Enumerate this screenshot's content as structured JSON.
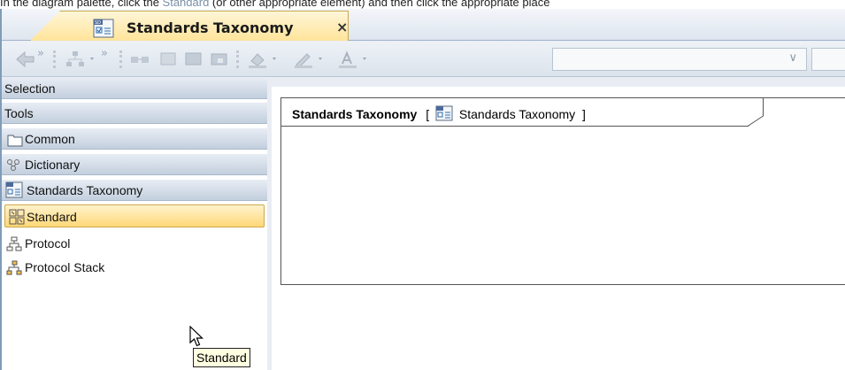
{
  "caption": {
    "prefix": "In the diagram palette, click the ",
    "link1": "Standard",
    "middle": " (or other appropriate element) and then click the appropriate place"
  },
  "tab": {
    "title": "Standards Taxonomy",
    "close": "×",
    "icon": "sd-diagram-icon"
  },
  "toolbar": {
    "overflow1": "»",
    "overflow2": "»",
    "combo_arrow": "∨"
  },
  "palette": {
    "headers": [
      "Selection",
      "Tools"
    ],
    "groups": [
      {
        "label": "Common",
        "icon": "folder-icon"
      },
      {
        "label": "Dictionary",
        "icon": "dictionary-icon"
      },
      {
        "label": "Standards Taxonomy",
        "icon": "sd-diagram-icon"
      }
    ],
    "items": [
      {
        "label": "Standard",
        "icon": "standard-icon",
        "selected": true
      },
      {
        "label": "Protocol",
        "icon": "protocol-icon"
      },
      {
        "label": "Protocol Stack",
        "icon": "protocol-stack-icon"
      }
    ]
  },
  "tooltip": "Standard",
  "diagram": {
    "frame_name": "Standards Taxonomy",
    "open_bracket": "[",
    "type_label": "Standards Taxonomy",
    "close_bracket": "]"
  },
  "colors": {
    "selection_fill": "#ffd877",
    "tab_fill": "#ffe49a",
    "header_fill": "#c3cfde",
    "link": "#7a8fa6"
  }
}
